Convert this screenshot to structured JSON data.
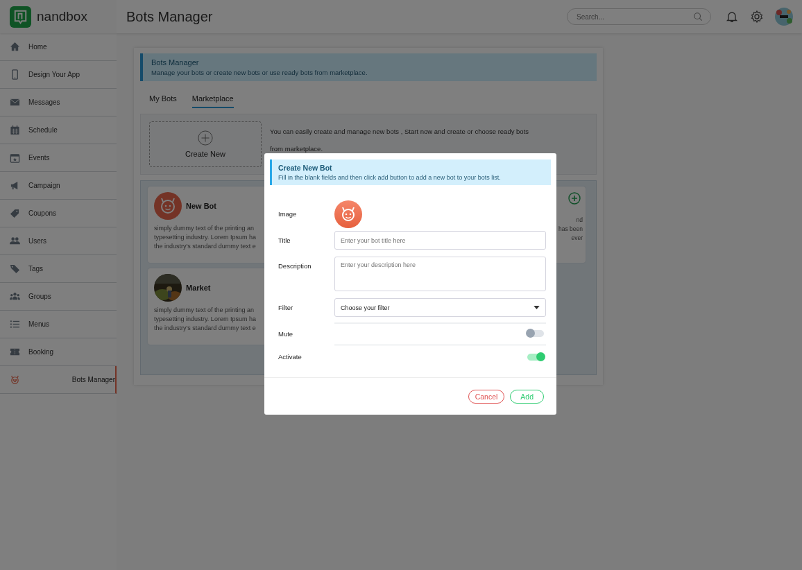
{
  "logo": {
    "text": "nandbox"
  },
  "header": {
    "title": "Bots Manager",
    "search": {
      "placeholder": "Search..."
    }
  },
  "sidebar": {
    "items": [
      {
        "label": "Home",
        "selected": false
      },
      {
        "label": "Design Your App",
        "selected": false
      },
      {
        "label": "Messages",
        "selected": false
      },
      {
        "label": "Schedule",
        "selected": false
      },
      {
        "label": "Events",
        "selected": false
      },
      {
        "label": "Campaign",
        "selected": false
      },
      {
        "label": "Coupons",
        "selected": false
      },
      {
        "label": "Users",
        "selected": false
      },
      {
        "label": "Tags",
        "selected": false
      },
      {
        "label": "Groups",
        "selected": false
      },
      {
        "label": "Menus",
        "selected": false
      },
      {
        "label": "Booking",
        "selected": false
      },
      {
        "label": "Bots Manager",
        "selected": true
      }
    ]
  },
  "banner": {
    "title": "Bots Manager",
    "text": "Manage your bots or create new bots or use ready bots from marketplace."
  },
  "tabs": [
    {
      "label": "My Bots",
      "selected": false
    },
    {
      "label": "Marketplace",
      "selected": true
    }
  ],
  "create_new": {
    "label": "Create New",
    "text": "You can easily create and manage new bots , Start now and create or choose ready bots from marketplace."
  },
  "bots": [
    {
      "name": "New Bot",
      "kind": "robot",
      "lines": [
        "simply dummy text of the printing an",
        "typesetting industry. Lorem Ipsum ha",
        "the industry's standard dummy text e"
      ]
    },
    {
      "name": "Market",
      "kind": "picture",
      "lines": [
        "simply dummy text of the printing an",
        "typesetting industry. Lorem Ipsum ha",
        "the industry's standard dummy text e"
      ]
    }
  ],
  "right_card": {
    "lines": [
      "nd",
      "has been",
      "ever"
    ]
  },
  "modal": {
    "title": "Create New Bot",
    "subtitle": "Fill in the blank fields and then click add button to add a new bot to your bots list.",
    "fields": [
      {
        "label": "Image"
      },
      {
        "label": "Title",
        "kind": "input",
        "placeholder": "Enter your bot title here"
      },
      {
        "label": "Description",
        "kind": "textarea",
        "placeholder": "Enter your description here"
      },
      {
        "label": "Filter",
        "kind": "select",
        "value": "Choose your filter"
      },
      {
        "label": "Mute",
        "kind": "toggle",
        "on": false
      },
      {
        "label": "Activate",
        "kind": "toggle",
        "on": true
      }
    ],
    "buttons": [
      {
        "label": "Cancel",
        "kind": "cancel"
      },
      {
        "label": "Add",
        "kind": "add"
      }
    ]
  }
}
